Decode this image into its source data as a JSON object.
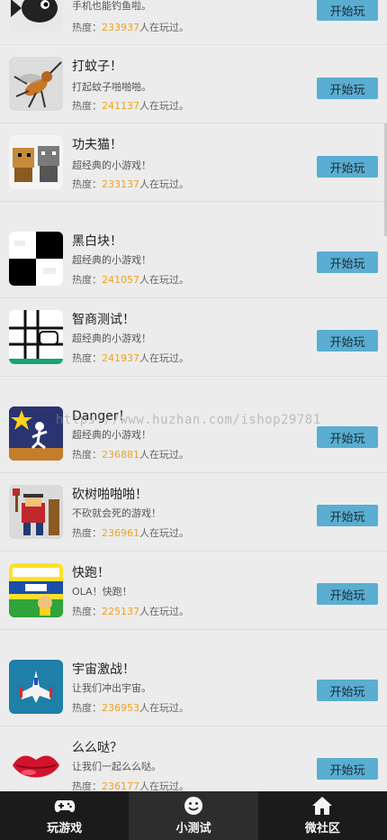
{
  "games": [
    {
      "title": "",
      "desc": "手机也能钓鱼啦。",
      "heat": "233937",
      "icon": "fish-icon"
    },
    {
      "title": "打蚊子！",
      "desc": "打起蚊子啪啪啪。",
      "heat": "241137",
      "icon": "mosquito-icon"
    },
    {
      "title": "功夫猫！",
      "desc": "超经典的小游戏！",
      "heat": "233137",
      "icon": "kungfu-cat-icon"
    },
    {
      "title": "黑白块！",
      "desc": "超经典的小游戏！",
      "heat": "241057",
      "icon": "black-white-tiles-icon"
    },
    {
      "title": "智商测试！",
      "desc": "超经典的小游戏！",
      "heat": "241937",
      "icon": "iq-test-grid-icon"
    },
    {
      "title": "Danger！",
      "desc": "超经典的小游戏！",
      "heat": "236881",
      "icon": "danger-runner-icon"
    },
    {
      "title": "砍树啪啪啪！",
      "desc": "不砍就会死的游戏！",
      "heat": "236961",
      "icon": "lumberjack-icon"
    },
    {
      "title": "快跑！",
      "desc": "OLA！快跑！",
      "heat": "225137",
      "icon": "run-ola-icon"
    },
    {
      "title": "宇宙激战！",
      "desc": "让我们冲出宇宙。",
      "heat": "236953",
      "icon": "spaceship-icon"
    },
    {
      "title": "么么哒？",
      "desc": "让我们一起么么哒。",
      "heat": "236177",
      "icon": "lips-icon"
    }
  ],
  "labels": {
    "heat_prefix": "热度：",
    "heat_suffix": "人在玩过。",
    "play_button": "开始玩"
  },
  "watermark": "https://www.huzhan.com/ishop29781",
  "tabs": [
    {
      "label": "玩游戏",
      "icon": "gamepad-icon",
      "active": false
    },
    {
      "label": "小测试",
      "icon": "smiley-icon",
      "active": true
    },
    {
      "label": "微社区",
      "icon": "home-icon",
      "active": false
    }
  ],
  "colors": {
    "accent_button": "#5aaed1",
    "heat_number": "#f0a21c",
    "tabbar": "#1b1b1b"
  }
}
